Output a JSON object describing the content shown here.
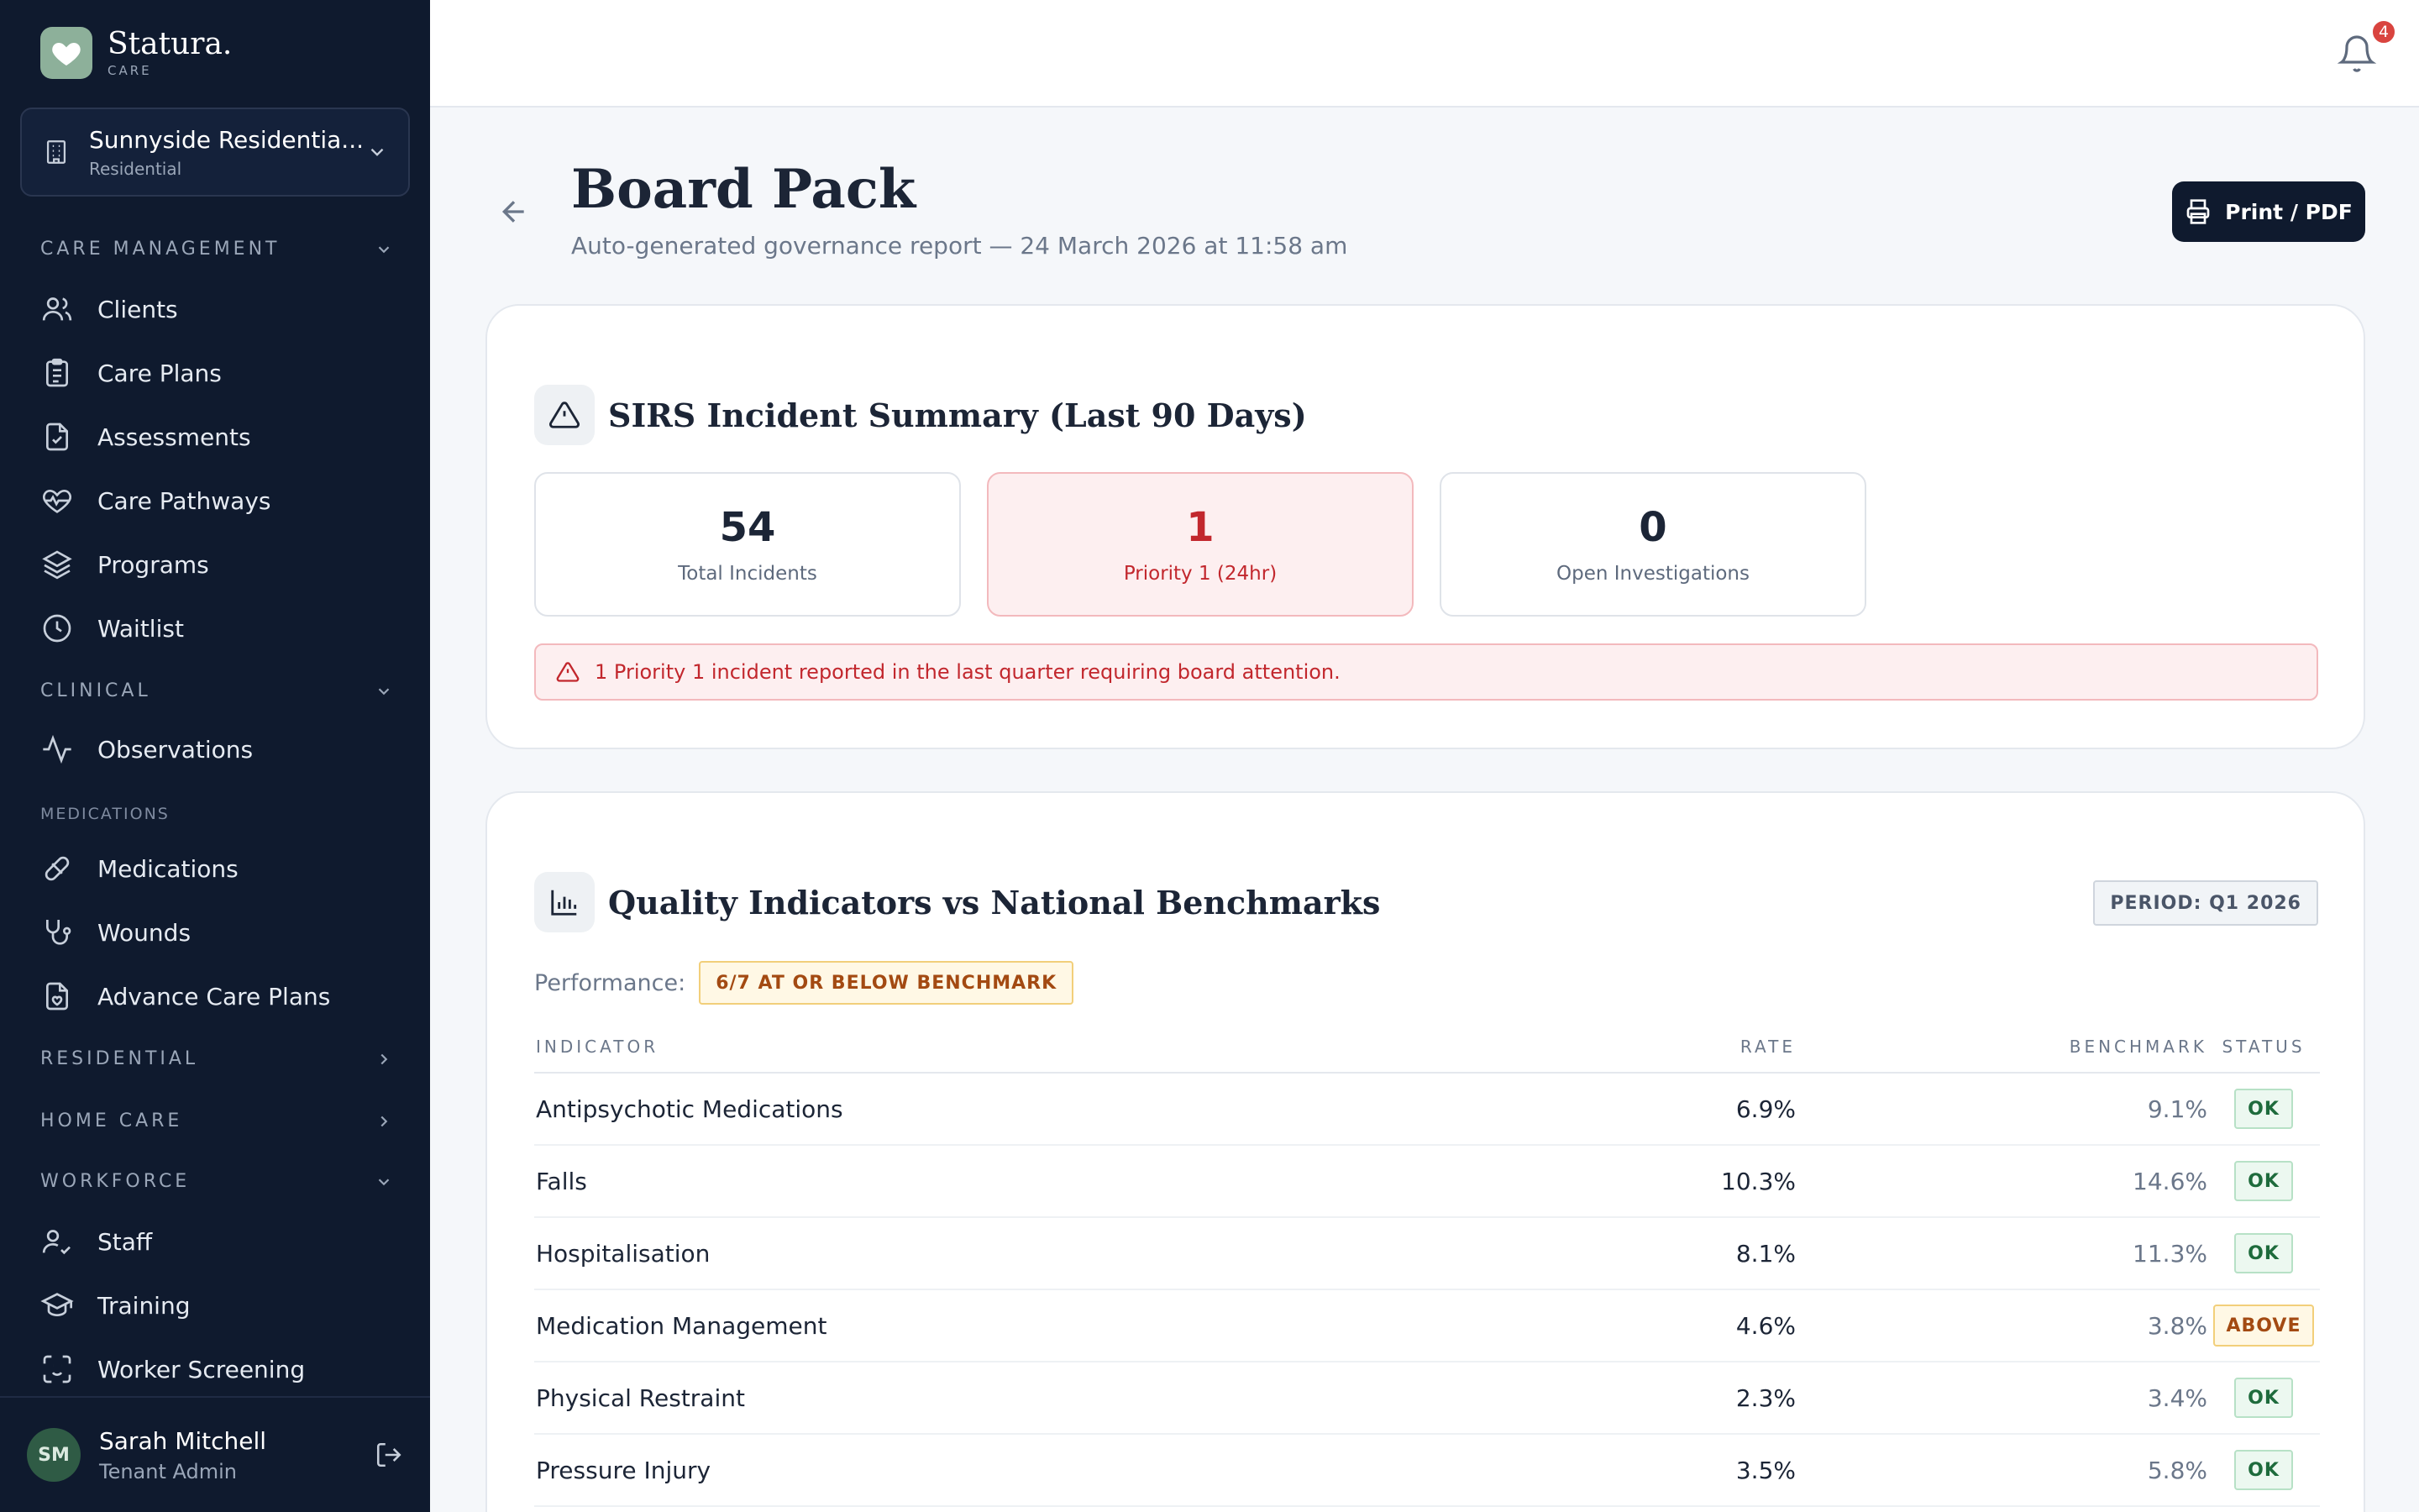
{
  "brand": {
    "name": "Statura.",
    "sub": "CARE"
  },
  "site": {
    "name": "Sunnyside Residentia...",
    "type": "Residential"
  },
  "nav": {
    "care_management": "CARE MANAGEMENT",
    "clients": "Clients",
    "care_plans": "Care Plans",
    "assessments": "Assessments",
    "care_pathways": "Care Pathways",
    "programs": "Programs",
    "waitlist": "Waitlist",
    "clinical": "CLINICAL",
    "observations": "Observations",
    "medications_sub": "MEDICATIONS",
    "medications": "Medications",
    "wounds": "Wounds",
    "advance_care_plans": "Advance Care Plans",
    "residential": "RESIDENTIAL",
    "home_care": "HOME CARE",
    "workforce": "WORKFORCE",
    "staff": "Staff",
    "training": "Training",
    "worker_screening": "Worker Screening"
  },
  "user": {
    "initials": "SM",
    "name": "Sarah Mitchell",
    "role": "Tenant Admin"
  },
  "notifications": {
    "count": "4"
  },
  "header": {
    "title": "Board Pack",
    "subtitle": "Auto-generated governance report — 24 March 2026 at 11:58 am",
    "print_label": "Print / PDF"
  },
  "sirs": {
    "title": "SIRS Incident Summary (Last 90 Days)",
    "stats": [
      {
        "value": "54",
        "label": "Total Incidents"
      },
      {
        "value": "1",
        "label": "Priority 1 (24hr)"
      },
      {
        "value": "0",
        "label": "Open Investigations"
      }
    ],
    "alert": "1 Priority 1 incident reported in the last quarter requiring board attention."
  },
  "quality": {
    "title": "Quality Indicators vs National Benchmarks",
    "period": "PERIOD: Q1 2026",
    "performance_label": "Performance:",
    "performance_badge": "6/7 AT OR BELOW BENCHMARK",
    "columns": {
      "indicator": "INDICATOR",
      "rate": "RATE",
      "benchmark": "BENCHMARK",
      "status": "STATUS"
    },
    "rows": [
      {
        "indicator": "Antipsychotic Medications",
        "rate": "6.9%",
        "benchmark": "9.1%",
        "status": "OK"
      },
      {
        "indicator": "Falls",
        "rate": "10.3%",
        "benchmark": "14.6%",
        "status": "OK"
      },
      {
        "indicator": "Hospitalisation",
        "rate": "8.1%",
        "benchmark": "11.3%",
        "status": "OK"
      },
      {
        "indicator": "Medication Management",
        "rate": "4.6%",
        "benchmark": "3.8%",
        "status": "ABOVE"
      },
      {
        "indicator": "Physical Restraint",
        "rate": "2.3%",
        "benchmark": "3.4%",
        "status": "OK"
      },
      {
        "indicator": "Pressure Injury",
        "rate": "3.5%",
        "benchmark": "5.8%",
        "status": "OK"
      }
    ]
  },
  "colors": {
    "sidebar": "#0f1a2e",
    "accent_dark": "#0f1a2e",
    "alert_red": "#c2272d",
    "ok_green": "#1e6b3c",
    "warn_amber": "#a34a12"
  }
}
